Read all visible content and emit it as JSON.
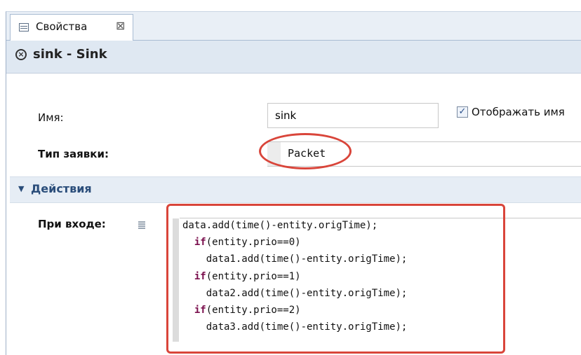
{
  "tab": {
    "label": "Свойства",
    "close_glyph": "⊠"
  },
  "title": "sink - Sink",
  "form": {
    "name_label": "Имя:",
    "name_value": "sink",
    "show_name_checked": true,
    "show_name_label": "Отображать имя",
    "type_label": "Тип заявки:",
    "type_value": "Packet"
  },
  "section": {
    "label": "Действия",
    "expanded": true
  },
  "on_enter": {
    "label": "При входе:",
    "code_lines": [
      {
        "indent": "",
        "keyword": "",
        "text": "data.add(time()-entity.origTime);"
      },
      {
        "indent": "  ",
        "keyword": "if",
        "text": "(entity.prio==0)"
      },
      {
        "indent": "    ",
        "keyword": "",
        "text": "data1.add(time()-entity.origTime);"
      },
      {
        "indent": "  ",
        "keyword": "if",
        "text": "(entity.prio==1)"
      },
      {
        "indent": "    ",
        "keyword": "",
        "text": "data2.add(time()-entity.origTime);"
      },
      {
        "indent": "  ",
        "keyword": "if",
        "text": "(entity.prio==2)"
      },
      {
        "indent": "    ",
        "keyword": "",
        "text": "data3.add(time()-entity.origTime);"
      }
    ]
  },
  "colors": {
    "annotation": "#d9453a",
    "section_text": "#2a4d7a",
    "keyword": "#7a0f4d"
  }
}
